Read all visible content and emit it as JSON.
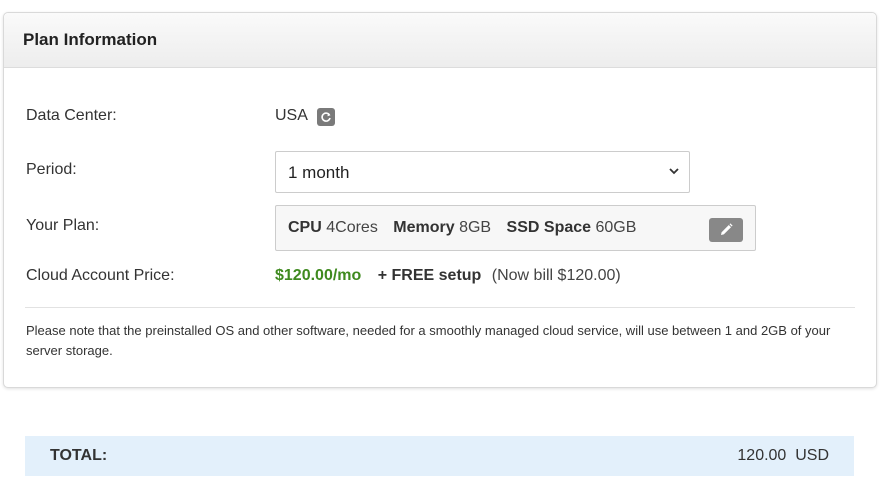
{
  "panel": {
    "title": "Plan Information"
  },
  "data_center": {
    "label": "Data Center:",
    "value": "USA",
    "icon": "refresh-icon"
  },
  "period": {
    "label": "Period:",
    "selected": "1 month"
  },
  "plan": {
    "label": "Your Plan:",
    "cpu_label": "CPU",
    "cpu_value": "4Cores",
    "memory_label": "Memory",
    "memory_value": "8GB",
    "ssd_label": "SSD Space",
    "ssd_value": "60GB",
    "edit_icon": "pencil-icon"
  },
  "price": {
    "label": "Cloud Account Price:",
    "amount": "$120.00/mo",
    "setup": "+ FREE setup",
    "bill": "(Now bill $120.00)",
    "accent_color": "#3f8a1f"
  },
  "note": "Please note that the preinstalled OS and other software, needed for a smoothly managed cloud service, will use between 1 and 2GB of your server storage.",
  "total": {
    "label": "TOTAL:",
    "value": "120.00  USD",
    "background_color": "#e3f0fb"
  }
}
